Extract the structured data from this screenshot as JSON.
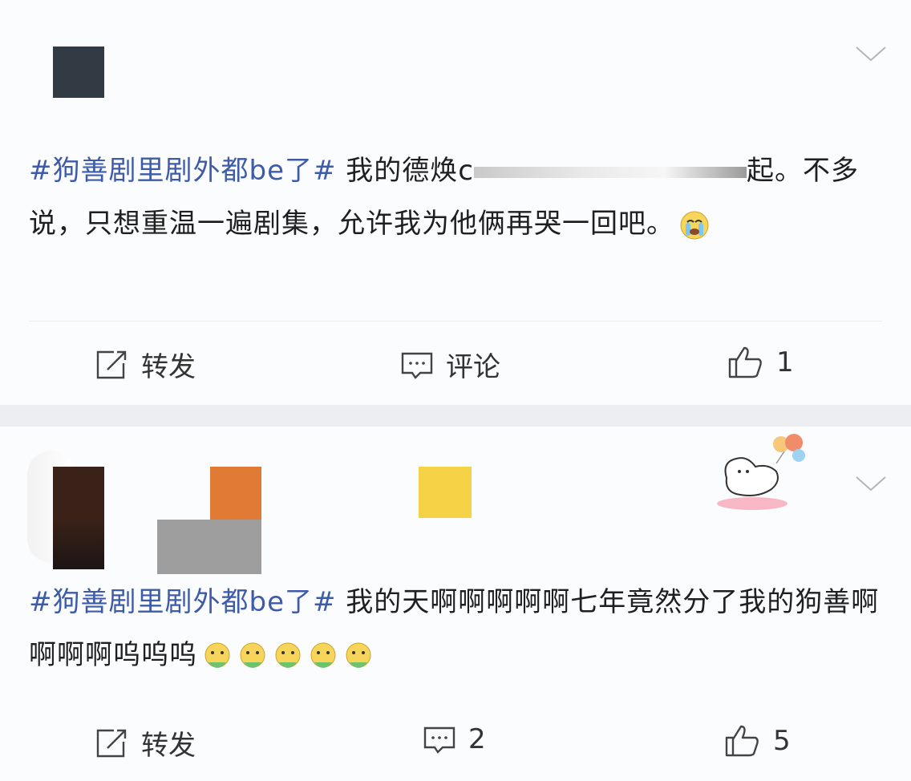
{
  "feed": {
    "posts": [
      {
        "hashtag": "#狗善剧里剧外都be了#",
        "text_before": " 我的德焕c",
        "text_after": "起。不多说，只想重温一遍剧集，允许我为他俩再哭一回吧。",
        "emojis": [
          "crying-emoji"
        ],
        "actions": {
          "repost_label": "转发",
          "comment_label": "评论",
          "like_count": "1"
        }
      },
      {
        "hashtag": "#狗善剧里剧外都be了#",
        "text": " 我的天啊啊啊啊啊七年竟然分了我的狗善啊啊啊啊呜呜呜",
        "emojis": [
          "sick-emoji",
          "sick-emoji",
          "sick-emoji",
          "sick-emoji",
          "sick-emoji"
        ],
        "actions": {
          "repost_label": "转发",
          "comment_count": "2",
          "like_count": "5"
        }
      }
    ]
  },
  "colors": {
    "hashtag": "#3d5ba8",
    "background": "#fbfcfe",
    "separator": "#eceef1"
  }
}
